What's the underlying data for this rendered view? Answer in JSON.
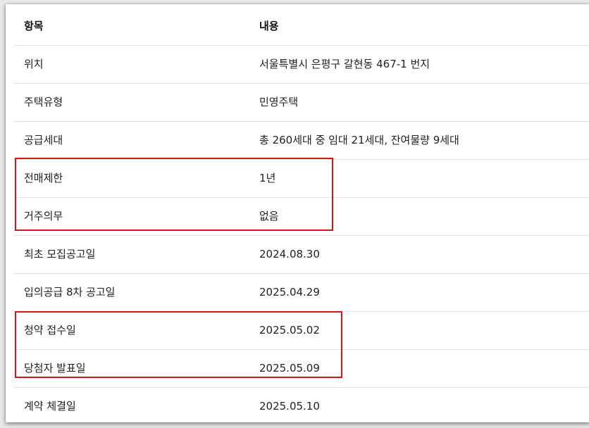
{
  "table": {
    "header": {
      "key": "항목",
      "value": "내용"
    },
    "rows": [
      {
        "key": "위치",
        "value": "서울특별시 은평구 갈현동 467-1 번지"
      },
      {
        "key": "주택유형",
        "value": "민영주택"
      },
      {
        "key": "공급세대",
        "value": "총 260세대 중 임대 21세대, 잔여물량 9세대"
      },
      {
        "key": "전매제한",
        "value": "1년"
      },
      {
        "key": "거주의무",
        "value": "없음"
      },
      {
        "key": "최초 모집공고일",
        "value": "2024.08.30"
      },
      {
        "key": "입의공급 8차 공고일",
        "value": "2025.04.29"
      },
      {
        "key": "청약 접수일",
        "value": "2025.05.02"
      },
      {
        "key": "당첨자 발표일",
        "value": "2025.05.09"
      },
      {
        "key": "계약 체결일",
        "value": "2025.05.10"
      }
    ]
  },
  "highlight_color": "#d0191b"
}
